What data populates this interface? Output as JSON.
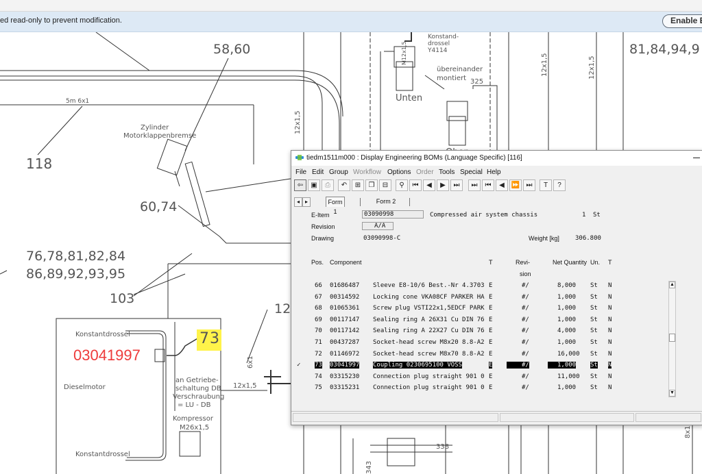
{
  "infobar": {
    "message": "ed read-only to prevent modification.",
    "button_label": "Enable E"
  },
  "drawing_labels": {
    "l5860": "58,60",
    "l8184": "81,84,94,9",
    "l118": "118",
    "l6074": "60,74",
    "l7684": "76,78,81,82,84",
    "l8695": "86,89,92,93,95",
    "l103": "103",
    "l12": "12",
    "pipe_5m": "5m 6x1",
    "zylinder": "Zylinder",
    "motorklappe": "Motorklappenbremse",
    "konstand1": "Konstand-",
    "konstand2": "drossel",
    "y4114": "Y4114",
    "m12": "M12x1,5",
    "uebereinander1": "übereinander",
    "uebereinander2": "montiert",
    "n325": "325",
    "unten": "Unten",
    "oben": "Oben",
    "dim12_1": "12x1,5",
    "dim12_2": "12x1,5",
    "dim12_3": "12x1,5",
    "dim12_4": "12x1,5",
    "konstantdrossel_top": "Konstantdrossel",
    "konstantdrossel_bottom": "Konstantdrossel",
    "dieselmotor": "Dieselmotor",
    "getriebe1": "an Getriebe-",
    "getriebe2": "schaltung DB",
    "getriebe3": "Verschraubung",
    "getriebe4": "= LU - DB",
    "kompressor1": "Kompressor",
    "kompressor2": "M26x1,5",
    "dim6x1": "6x1",
    "n338": "338",
    "n343": "343",
    "dim8x1": "8x1",
    "highlight": "73",
    "red_callout": "03041997"
  },
  "window": {
    "title": "tiedm1511m000 : Display Engineering BOMs (Language Specific) [116]",
    "menu": [
      "File",
      "Edit",
      "Group",
      "Workflow",
      "Options",
      "Order",
      "Tools",
      "Special",
      "Help"
    ],
    "menu_disabled": [
      "Workflow",
      "Order"
    ],
    "toolbar_icons": [
      "exit-icon",
      "save-icon",
      "print-icon",
      "undo-icon",
      "tree-icon",
      "copy-icon",
      "structure-icon",
      "find-icon",
      "first-record-icon",
      "previous-record-icon",
      "next-record-icon",
      "last-record-icon",
      "first-set-icon",
      "previous-set-icon",
      "next-set-icon",
      "last-set-icon",
      "text-icon",
      "help-icon"
    ],
    "tabs": [
      "Form 1",
      "Form 2"
    ],
    "header": {
      "eitem_label": "E-Item",
      "eitem_value": "03090998",
      "eitem_desc": "Compressed air system chassis",
      "eitem_qty": "1",
      "eitem_unit": "St",
      "revision_label": "Revision",
      "revision_value": "A/A",
      "drawing_label": "Drawing",
      "drawing_value": "03090998-C",
      "weight_label": "Weight [kg]",
      "weight_value": "306.800"
    },
    "columns": {
      "pos": "Pos.",
      "component": "Component",
      "t": "T",
      "revision1": "Revi-",
      "revision2": "sion",
      "netqty": "Net Quantity",
      "unit": "Un.",
      "t2": "T"
    },
    "rows": [
      {
        "pos": "66",
        "comp": "01686487",
        "desc": "Sleeve E8-10/6 Best.-Nr 4.3703",
        "t": "E",
        "rev": "#/",
        "qty": "8,000",
        "un": "St",
        "t2": "N",
        "mark": ""
      },
      {
        "pos": "67",
        "comp": "00314592",
        "desc": "Locking cone VKA08CF PARKER HA",
        "t": "E",
        "rev": "#/",
        "qty": "1,000",
        "un": "St",
        "t2": "N",
        "mark": ""
      },
      {
        "pos": "68",
        "comp": "01065361",
        "desc": "Screw plug VSTI22x1,5EDCF PARK",
        "t": "E",
        "rev": "#/",
        "qty": "1,000",
        "un": "St",
        "t2": "N",
        "mark": ""
      },
      {
        "pos": "69",
        "comp": "00117147",
        "desc": "Sealing ring A 26X31 Cu DIN 76",
        "t": "E",
        "rev": "#/",
        "qty": "1,000",
        "un": "St",
        "t2": "N",
        "mark": ""
      },
      {
        "pos": "70",
        "comp": "00117142",
        "desc": "Sealing ring A 22X27 Cu DIN 76",
        "t": "E",
        "rev": "#/",
        "qty": "4,000",
        "un": "St",
        "t2": "N",
        "mark": ""
      },
      {
        "pos": "71",
        "comp": "00437287",
        "desc": "Socket-head screw M8x20 8.8-A2",
        "t": "E",
        "rev": "#/",
        "qty": "1,000",
        "un": "St",
        "t2": "N",
        "mark": ""
      },
      {
        "pos": "72",
        "comp": "01146972",
        "desc": "Socket-head screw M8x70 8.8-A2",
        "t": "E",
        "rev": "#/",
        "qty": "16,000",
        "un": "St",
        "t2": "N",
        "mark": ""
      },
      {
        "pos": "73",
        "comp": "03041997",
        "desc": "Coupling 0230695100 VOSS",
        "t": "E",
        "rev": "#/",
        "qty": "1,000",
        "un": "St",
        "t2": "N",
        "mark": "✓"
      },
      {
        "pos": "74",
        "comp": "03315230",
        "desc": "Connection plug straight 901 0",
        "t": "E",
        "rev": "#/",
        "qty": "11,000",
        "un": "St",
        "t2": "N",
        "mark": ""
      },
      {
        "pos": "75",
        "comp": "03315231",
        "desc": "Connection plug straight 901 0",
        "t": "E",
        "rev": "#/",
        "qty": "1,000",
        "un": "St",
        "t2": "N",
        "mark": ""
      }
    ],
    "selected_row": 7
  }
}
